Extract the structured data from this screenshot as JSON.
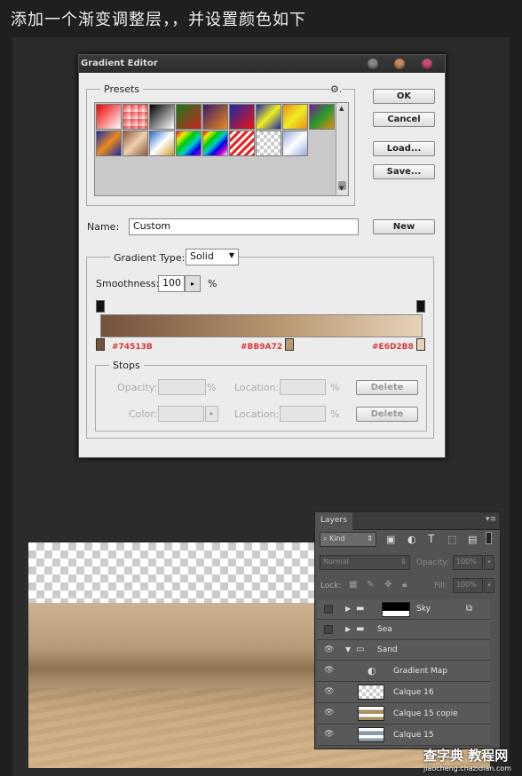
{
  "instruction": "添加一个渐变调整层，，并设置颜色如下",
  "dialog": {
    "title": "Gradient Editor",
    "presets_label": "Presets",
    "buttons": {
      "ok": "OK",
      "cancel": "Cancel",
      "load": "Load...",
      "save": "Save...",
      "new": "New"
    },
    "name_label": "Name:",
    "name_value": "Custom",
    "gradient_type_label": "Gradient Type:",
    "gradient_type_value": "Solid",
    "smoothness_label": "Smoothness:",
    "smoothness_value": "100",
    "percent": "%",
    "stops_label": "Stops",
    "opacity_label": "Opacity:",
    "color_label": "Color:",
    "location_label": "Location:",
    "delete_label": "Delete",
    "stop_colors": [
      "#74513B",
      "#BB9A72",
      "#E6D2B8"
    ]
  },
  "layers_panel": {
    "tab": "Layers",
    "kind_label": "Kind",
    "blend_mode": "Normal",
    "opacity_label": "Opacity:",
    "opacity_value": "100%",
    "lock_label": "Lock:",
    "fill_label": "Fill:",
    "fill_value": "100%",
    "layers": [
      {
        "name": "Sky",
        "visible": false
      },
      {
        "name": "Sea",
        "visible": false
      },
      {
        "name": "Sand",
        "visible": true
      },
      {
        "name": "Gradient Map",
        "visible": true
      },
      {
        "name": "Calque 16",
        "visible": true
      },
      {
        "name": "Calque 15 copie",
        "visible": true
      },
      {
        "name": "Calque 15",
        "visible": true
      }
    ]
  },
  "watermark": {
    "main": "查字典 教程网",
    "sub": "jiaocheng.chazidian.com"
  }
}
